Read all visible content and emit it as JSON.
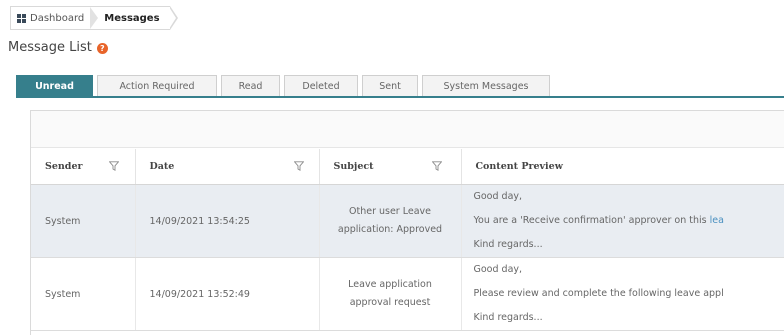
{
  "breadcrumb": {
    "items": [
      {
        "label": "Dashboard"
      },
      {
        "label": "Messages"
      }
    ]
  },
  "page": {
    "title": "Message List",
    "help_glyph": "?"
  },
  "tabs": [
    {
      "label": "Unread",
      "active": true
    },
    {
      "label": "Action Required"
    },
    {
      "label": "Read"
    },
    {
      "label": "Deleted"
    },
    {
      "label": "Sent"
    },
    {
      "label": "System Messages"
    }
  ],
  "table": {
    "columns": [
      {
        "label": "Sender",
        "filter": true
      },
      {
        "label": "Date",
        "filter": true
      },
      {
        "label": "Subject",
        "filter": true
      },
      {
        "label": "Content Preview",
        "filter": false
      }
    ],
    "rows": [
      {
        "sender": "System",
        "date": "14/09/2021 13:54:25",
        "subject": "Other user Leave application: Approved",
        "preview": [
          "Good day,",
          "You are a 'Receive confirmation' approver on this ",
          "Kind regards..."
        ],
        "preview_link": "lea",
        "selected": true
      },
      {
        "sender": "System",
        "date": "14/09/2021 13:52:49",
        "subject": "Leave application approval request",
        "preview": [
          "Good day,",
          "Please review and complete the following leave appl",
          "Kind regards..."
        ],
        "preview_link": "",
        "selected": false
      }
    ]
  },
  "colors": {
    "accent": "#367f8c",
    "help": "#e8642a",
    "selected_row": "#e9edf2",
    "link": "#4a90c0"
  }
}
